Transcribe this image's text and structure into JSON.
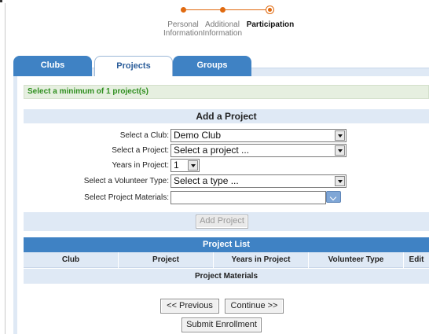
{
  "steps": [
    {
      "line1": "Personal",
      "line2": "Information"
    },
    {
      "line1": "Additional",
      "line2": "Information"
    },
    {
      "line1": "Participation",
      "line2": ""
    }
  ],
  "tabs": [
    "Clubs",
    "Projects",
    "Groups"
  ],
  "notice": "Select a minimum of 1 project(s)",
  "add_project": {
    "title": "Add a Project",
    "club_label": "Select a Club:",
    "club_value": "Demo Club",
    "project_label": "Select a Project:",
    "project_value": "Select a project ...",
    "years_label": "Years in Project:",
    "years_value": "1",
    "volunteer_label": "Select a Volunteer Type:",
    "volunteer_value": "Select a type ...",
    "materials_label": "Select Project Materials:",
    "materials_value": "",
    "add_button": "Add Project"
  },
  "project_list": {
    "title": "Project List",
    "columns": [
      "Club",
      "Project",
      "Years in Project",
      "Volunteer Type",
      "Edit"
    ],
    "materials_header": "Project Materials"
  },
  "nav": {
    "previous": "<< Previous",
    "continue": "Continue >>",
    "submit": "Submit Enrollment"
  },
  "colors": {
    "accent_orange": "#e06a10",
    "tab_blue": "#3f82c4",
    "panel_blue": "#dfe9f5",
    "notice_green": "#2f8f1f"
  }
}
